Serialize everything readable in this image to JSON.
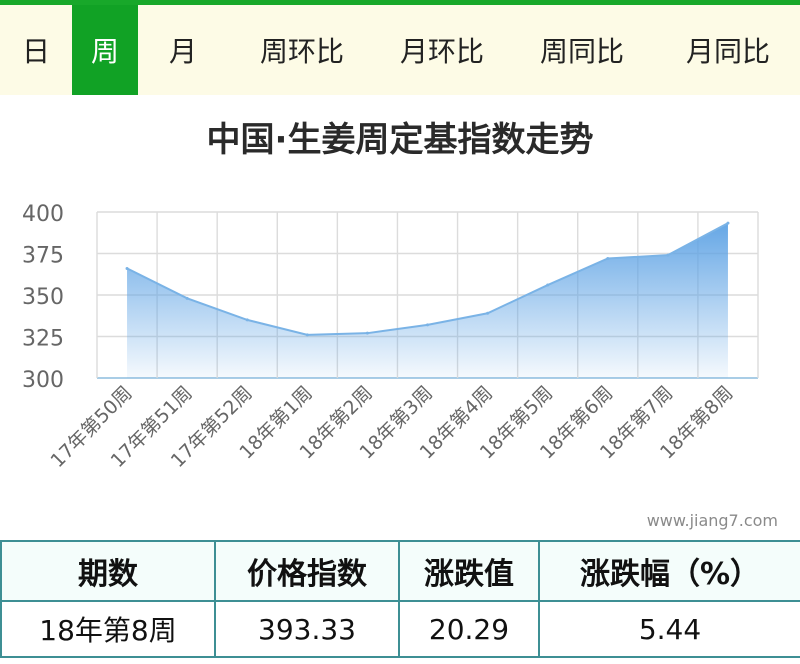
{
  "tabs": [
    {
      "label": "日",
      "active": false
    },
    {
      "label": "周",
      "active": true
    },
    {
      "label": "月",
      "active": false
    },
    {
      "label": "周环比",
      "active": false
    },
    {
      "label": "月环比",
      "active": false
    },
    {
      "label": "周同比",
      "active": false
    },
    {
      "label": "月同比",
      "active": false
    }
  ],
  "colors": {
    "accent": "#11a225",
    "line": "#7ab3e6",
    "fill_top": "#5da2e4"
  },
  "chart_data": {
    "type": "area",
    "title": "中国·生姜周定基指数走势",
    "categories": [
      "17年第50周",
      "17年第51周",
      "17年第52周",
      "18年第1周",
      "18年第2周",
      "18年第3周",
      "18年第4周",
      "18年第5周",
      "18年第6周",
      "18年第7周",
      "18年第8周"
    ],
    "values": [
      366,
      348,
      335,
      326,
      327,
      332,
      339,
      356,
      372,
      374,
      393.33
    ],
    "ylim": [
      300,
      400
    ],
    "yticks": [
      300,
      325,
      350,
      375,
      400
    ],
    "grid": true
  },
  "watermark": "www.jiang7.com",
  "summary": {
    "headers": [
      "期数",
      "价格指数",
      "涨跌值",
      "涨跌幅（%）"
    ],
    "row": [
      "18年第8周",
      "393.33",
      "20.29",
      "5.44"
    ]
  }
}
